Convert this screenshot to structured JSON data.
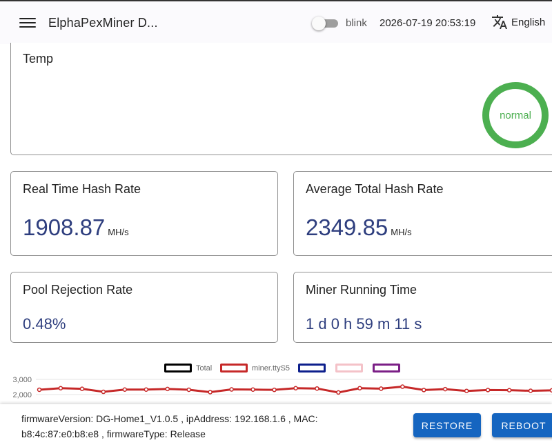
{
  "header": {
    "title": "ElphaPexMiner D...",
    "blink_label": "blink",
    "blink_on": false,
    "datetime": "2026-07-19 20:53:19",
    "language": "English"
  },
  "temp": {
    "title": "Temp",
    "status": "normal",
    "status_color": "#4caf50"
  },
  "stats": {
    "realtime": {
      "title": "Real Time Hash Rate",
      "value": "1908.87",
      "unit": "MH/s"
    },
    "average": {
      "title": "Average Total Hash Rate",
      "value": "2349.85",
      "unit": "MH/s"
    },
    "rejection": {
      "title": "Pool Rejection Rate",
      "value": "0.48%"
    },
    "runtime": {
      "title": "Miner Running Time",
      "value": "1 d 0 h 59 m 11 s"
    }
  },
  "chart_data": {
    "type": "line",
    "legend": [
      {
        "name": "Total",
        "color": "#000000"
      },
      {
        "name": "miner.ttyS5",
        "color": "#c62828"
      },
      {
        "name": "",
        "color": "#0d1f8c"
      },
      {
        "name": "",
        "color": "#f4c2c8"
      },
      {
        "name": "",
        "color": "#7b1f86"
      }
    ],
    "y_ticks": [
      "3,000",
      "2,000"
    ],
    "ylim": [
      1500,
      3000
    ],
    "series": [
      {
        "name": "miner.ttyS5",
        "color": "#c62828",
        "values": [
          2320,
          2420,
          2380,
          2180,
          2330,
          2330,
          2370,
          2320,
          2160,
          2340,
          2330,
          2310,
          2420,
          2400,
          2140,
          2420,
          2390,
          2520,
          2300,
          2360,
          2240,
          2300,
          2290,
          2250,
          2280
        ]
      }
    ]
  },
  "footer": {
    "firmware_line1": "firmwareVersion: DG-Home1_V1.0.5 , ipAddress: 192.168.1.6 , MAC:",
    "firmware_line2": "b8:4c:87:e0:b8:e8 , firmwareType: Release",
    "restore_label": "RESTORE",
    "reboot_label": "REBOOT"
  }
}
